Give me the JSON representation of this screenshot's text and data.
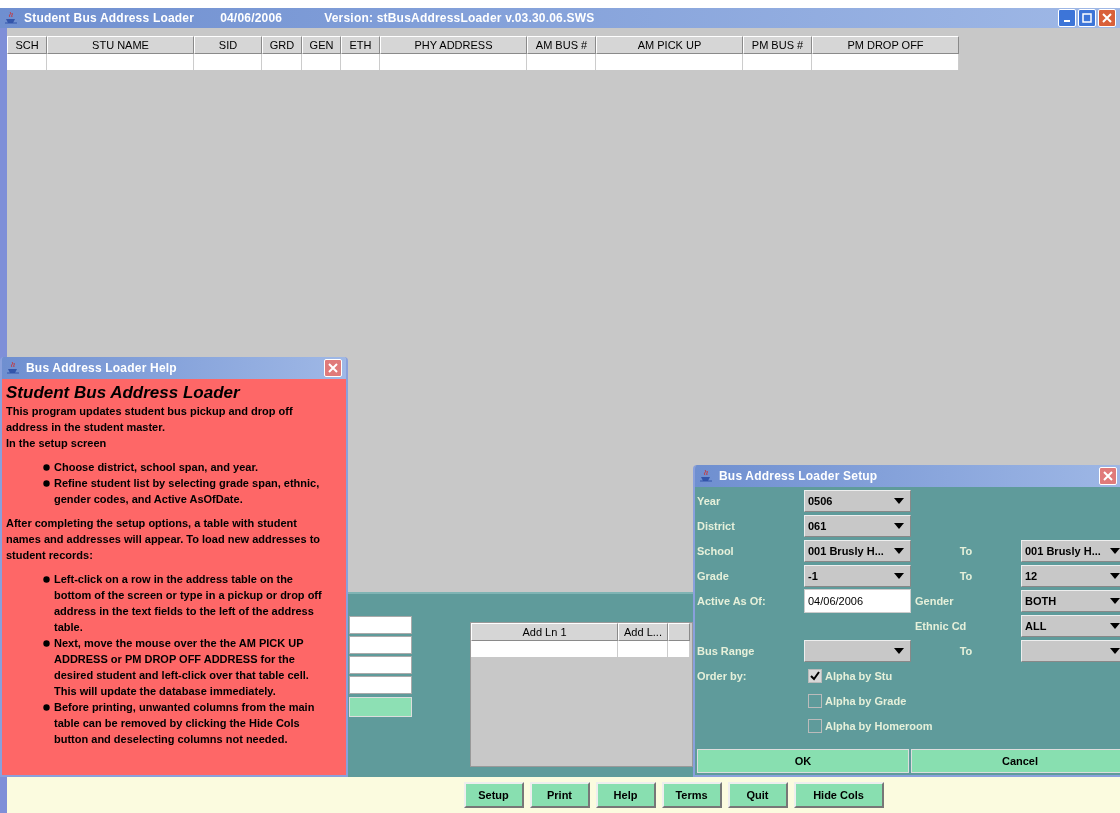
{
  "window": {
    "title": "Student Bus Address Loader",
    "date": "04/06/2006",
    "version": "Version:  stBusAddressLoader v.03.30.06.SWS"
  },
  "table": {
    "columns": [
      "SCH",
      "STU NAME",
      "SID",
      "GRD",
      "GEN",
      "ETH",
      "PHY ADDRESS",
      "AM BUS #",
      "AM PICK UP",
      "PM BUS #",
      "PM DROP OFF"
    ]
  },
  "address_table": {
    "columns": [
      "Add Ln 1",
      "Add L..."
    ]
  },
  "buttons": [
    "Setup",
    "Print",
    "Help",
    "Terms",
    "Quit",
    "Hide Cols"
  ],
  "help_window": {
    "title": "Bus Address Loader Help",
    "heading": "Student Bus Address Loader",
    "content": [
      {
        "kind": "text",
        "text": "This program updates student bus pickup and drop off address in the student master."
      },
      {
        "kind": "text",
        "text": "In the setup screen"
      },
      {
        "kind": "bullets",
        "items": [
          "Choose district, school span, and year.",
          "Refine student list by selecting grade span, ethnic, gender codes, and Active AsOfDate."
        ]
      },
      {
        "kind": "text",
        "text": "After completing the setup options, a table with student names and addresses will appear. To load new addresses to student records:"
      },
      {
        "kind": "bullets",
        "items": [
          "Left-click on a row in the address table on the bottom of the screen or type in a pickup or drop off address in the text fields to the left of the address table.",
          "Next, move the mouse over the the AM PICK UP ADDRESS or PM DROP OFF ADDRESS for the desired student and left-click over that table cell. This will update the database immediately.",
          "Before printing, unwanted columns from the main table can be removed by clicking the Hide Cols button and deselecting columns not needed."
        ]
      }
    ]
  },
  "setup_dialog": {
    "title": "Bus Address Loader Setup",
    "rows": [
      {
        "kind": "single",
        "label": "Year",
        "value": "0506"
      },
      {
        "kind": "single",
        "label": "District",
        "value": "061"
      },
      {
        "kind": "range",
        "label": "School",
        "value": "001 Brusly H...",
        "to_label": "To",
        "to_value": "001 Brusly H..."
      },
      {
        "kind": "range",
        "label": "Grade",
        "value": "-1",
        "to_label": "To",
        "to_value": "12"
      },
      {
        "kind": "date",
        "label": "Active As Of:",
        "value": "04/06/2006",
        "to_label": "Gender",
        "to_value": "BOTH"
      },
      {
        "kind": "filter",
        "to_label": "Ethnic Cd",
        "to_value": "ALL"
      },
      {
        "kind": "range",
        "label": "Bus Range",
        "to_label": "To"
      }
    ],
    "order_label": "Order by:",
    "order_options": [
      {
        "label": "Alpha by Stu",
        "checked": true
      },
      {
        "label": "Alpha by Grade",
        "checked": false
      },
      {
        "label": "Alpha by Homeroom",
        "checked": false
      }
    ],
    "buttons": [
      "OK",
      "Cancel"
    ]
  }
}
